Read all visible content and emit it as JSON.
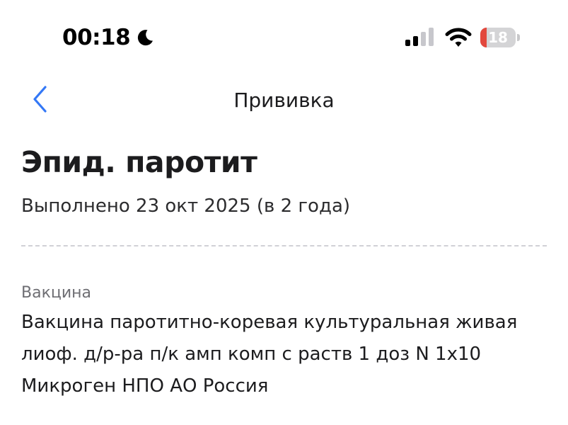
{
  "status_bar": {
    "time": "00:18",
    "focus_icon": "moon-icon",
    "signal_icon": "cellular-signal-icon",
    "wifi_icon": "wifi-icon",
    "battery_level": "18",
    "battery_fraction": 0.18,
    "battery_color": "#e2483d"
  },
  "nav": {
    "back_icon": "chevron-left-icon",
    "title": "Прививка",
    "accent_color": "#3478f6"
  },
  "vaccination": {
    "title": "Эпид. паротит",
    "completed": "Выполнено 23 окт 2025 (в 2 года)",
    "vaccine_label": "Вакцина",
    "vaccine_name": "Вакцина паротитно-коревая культуральная живая лиоф. д/р-ра п/к амп комп с раств 1 доз N 1х10 Микроген НПО АО Россия"
  }
}
